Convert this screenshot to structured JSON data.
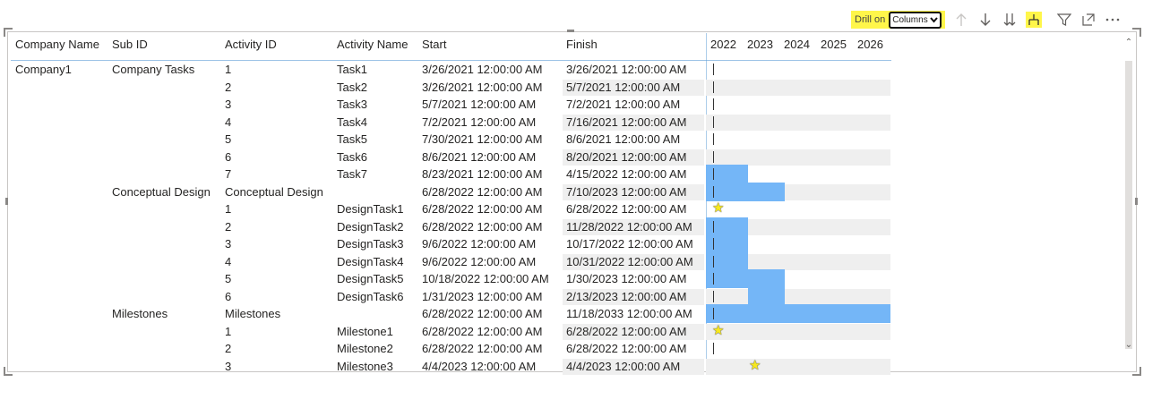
{
  "toolbar": {
    "drill_label": "Drill on",
    "drill_value": "Columns",
    "icons": [
      "arrow-up-icon",
      "arrow-down-icon",
      "double-arrow-down-icon",
      "expand-hierarchy-icon",
      "filter-icon",
      "focus-mode-icon",
      "more-options-icon"
    ]
  },
  "table": {
    "headers": {
      "company": "Company Name",
      "subid": "Sub ID",
      "activityid": "Activity ID",
      "activityname": "Activity Name",
      "start": "Start",
      "finish": "Finish"
    },
    "years": [
      "2022",
      "2023",
      "2024",
      "2025",
      "2026"
    ],
    "rows": [
      {
        "company": "Company1",
        "subid": "Company Tasks",
        "activityid": "1",
        "name": "Task1",
        "start": "3/26/2021 12:00:00 AM",
        "finish": "3/26/2021 12:00:00 AM",
        "bar": null,
        "star": null
      },
      {
        "company": "",
        "subid": "",
        "activityid": "2",
        "name": "Task2",
        "start": "3/26/2021 12:00:00 AM",
        "finish": "5/7/2021 12:00:00 AM",
        "bar": null,
        "star": null
      },
      {
        "company": "",
        "subid": "",
        "activityid": "3",
        "name": "Task3",
        "start": "5/7/2021 12:00:00 AM",
        "finish": "7/2/2021 12:00:00 AM",
        "bar": null,
        "star": null
      },
      {
        "company": "",
        "subid": "",
        "activityid": "4",
        "name": "Task4",
        "start": "7/2/2021 12:00:00 AM",
        "finish": "7/16/2021 12:00:00 AM",
        "bar": null,
        "star": null
      },
      {
        "company": "",
        "subid": "",
        "activityid": "5",
        "name": "Task5",
        "start": "7/30/2021 12:00:00 AM",
        "finish": "8/6/2021 12:00:00 AM",
        "bar": null,
        "star": null
      },
      {
        "company": "",
        "subid": "",
        "activityid": "6",
        "name": "Task6",
        "start": "8/6/2021 12:00:00 AM",
        "finish": "8/20/2021 12:00:00 AM",
        "bar": null,
        "star": null
      },
      {
        "company": "",
        "subid": "",
        "activityid": "7",
        "name": "Task7",
        "start": "8/23/2021 12:00:00 AM",
        "finish": "4/15/2022 12:00:00 AM",
        "bar": [
          2021.8,
          2022.95
        ],
        "star": null
      },
      {
        "company": "",
        "subid": "Conceptual Design",
        "activityid": "Conceptual Design",
        "name": "",
        "start": "6/28/2022 12:00:00 AM",
        "finish": "7/10/2023 12:00:00 AM",
        "bar": [
          2021.8,
          2023.95
        ],
        "star": null
      },
      {
        "company": "",
        "subid": "",
        "activityid": "1",
        "name": "DesignTask1",
        "start": "6/28/2022 12:00:00 AM",
        "finish": "6/28/2022 12:00:00 AM",
        "bar": null,
        "star": 2022
      },
      {
        "company": "",
        "subid": "",
        "activityid": "2",
        "name": "DesignTask2",
        "start": "6/28/2022 12:00:00 AM",
        "finish": "11/28/2022 12:00:00 AM",
        "bar": [
          2021.8,
          2022.95
        ],
        "star": null
      },
      {
        "company": "",
        "subid": "",
        "activityid": "3",
        "name": "DesignTask3",
        "start": "9/6/2022 12:00:00 AM",
        "finish": "10/17/2022 12:00:00 AM",
        "bar": [
          2021.8,
          2022.95
        ],
        "star": null
      },
      {
        "company": "",
        "subid": "",
        "activityid": "4",
        "name": "DesignTask4",
        "start": "9/6/2022 12:00:00 AM",
        "finish": "10/31/2022 12:00:00 AM",
        "bar": [
          2021.8,
          2022.95
        ],
        "star": null
      },
      {
        "company": "",
        "subid": "",
        "activityid": "5",
        "name": "DesignTask5",
        "start": "10/18/2022 12:00:00 AM",
        "finish": "1/30/2023 12:00:00 AM",
        "bar": [
          2021.8,
          2023.95
        ],
        "star": null
      },
      {
        "company": "",
        "subid": "",
        "activityid": "6",
        "name": "DesignTask6",
        "start": "1/31/2023 12:00:00 AM",
        "finish": "2/13/2023 12:00:00 AM",
        "bar": [
          2022.95,
          2023.95
        ],
        "star": null
      },
      {
        "company": "",
        "subid": "Milestones",
        "activityid": "Milestones",
        "name": "",
        "start": "6/28/2022 12:00:00 AM",
        "finish": "11/18/2033 12:00:00 AM",
        "bar": [
          2021.8,
          2026.9
        ],
        "star": null
      },
      {
        "company": "",
        "subid": "",
        "activityid": "1",
        "name": "Milestone1",
        "start": "6/28/2022 12:00:00 AM",
        "finish": "6/28/2022 12:00:00 AM",
        "bar": null,
        "star": 2022
      },
      {
        "company": "",
        "subid": "",
        "activityid": "2",
        "name": "Milestone2",
        "start": "6/28/2022 12:00:00 AM",
        "finish": "6/28/2022 12:00:00 AM",
        "bar": null,
        "star": null
      },
      {
        "company": "",
        "subid": "",
        "activityid": "3",
        "name": "Milestone3",
        "start": "4/4/2023 12:00:00 AM",
        "finish": "4/4/2023 12:00:00 AM",
        "bar": null,
        "star": 2023
      }
    ]
  },
  "colors": {
    "bar": "#74b6f7",
    "highlight": "#fff64a",
    "band": "#efefef",
    "star": "#f7e81e"
  }
}
